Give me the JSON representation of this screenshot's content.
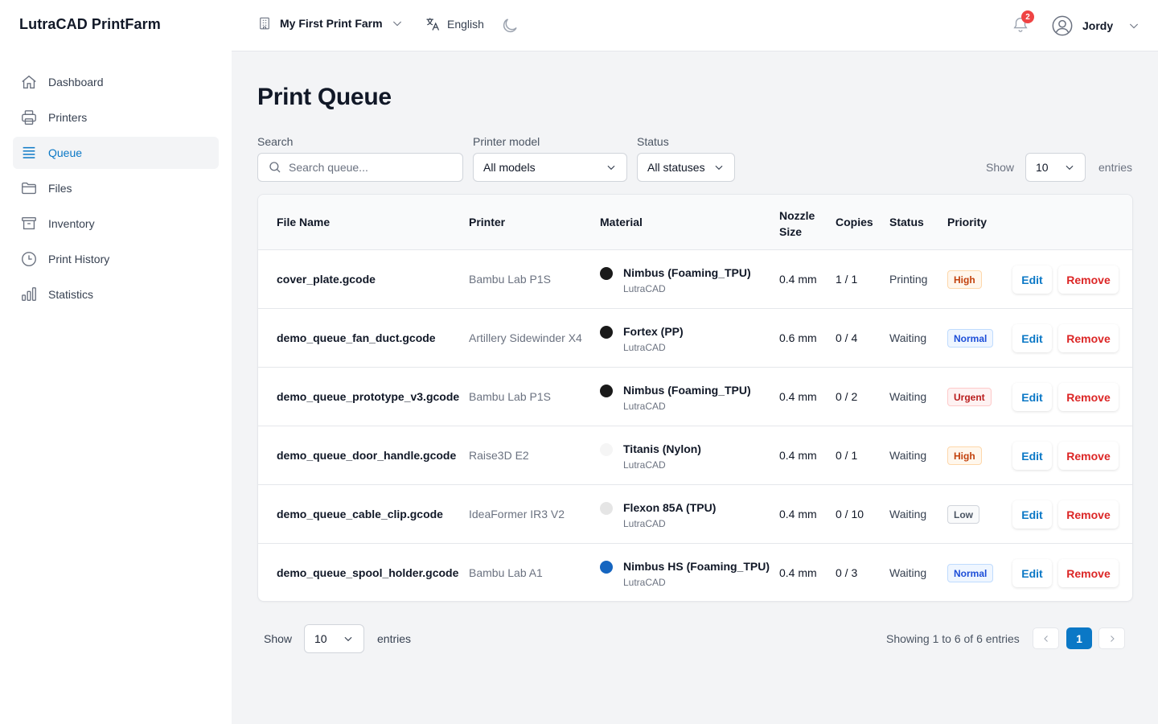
{
  "app": {
    "title": "LutraCAD PrintFarm"
  },
  "sidebar": {
    "items": [
      {
        "label": "Dashboard",
        "icon": "home-icon",
        "active": false
      },
      {
        "label": "Printers",
        "icon": "printer-icon",
        "active": false
      },
      {
        "label": "Queue",
        "icon": "queue-list-icon",
        "active": true
      },
      {
        "label": "Files",
        "icon": "folder-icon",
        "active": false
      },
      {
        "label": "Inventory",
        "icon": "archive-box-icon",
        "active": false
      },
      {
        "label": "Print History",
        "icon": "clock-icon",
        "active": false
      },
      {
        "label": "Statistics",
        "icon": "bar-chart-icon",
        "active": false
      }
    ]
  },
  "topbar": {
    "farm_name": "My First Print Farm",
    "language": "English",
    "notification_count": "2",
    "user_name": "Jordy"
  },
  "page": {
    "title": "Print Queue"
  },
  "filters": {
    "search_label": "Search",
    "search_placeholder": "Search queue...",
    "printer_model_label": "Printer model",
    "printer_model_value": "All models",
    "status_label": "Status",
    "status_value": "All statuses",
    "show_label": "Show",
    "show_value": "10",
    "entries_label": "entries"
  },
  "table": {
    "headers": {
      "file_name": "File Name",
      "printer": "Printer",
      "material": "Material",
      "nozzle_line1": "Nozzle",
      "nozzle_line2": "Size",
      "copies": "Copies",
      "status": "Status",
      "priority": "Priority"
    },
    "edit_label": "Edit",
    "remove_label": "Remove",
    "rows": [
      {
        "file": "cover_plate.gcode",
        "printer": "Bambu Lab P1S",
        "material": "Nimbus (Foaming_TPU)",
        "brand": "LutraCAD",
        "color": "#1a1a1a",
        "nozzle": "0.4 mm",
        "copies": "1 / 1",
        "status": "Printing",
        "priority": "High"
      },
      {
        "file": "demo_queue_fan_duct.gcode",
        "printer": "Artillery Sidewinder X4",
        "material": "Fortex (PP)",
        "brand": "LutraCAD",
        "color": "#1a1a1a",
        "nozzle": "0.6 mm",
        "copies": "0 / 4",
        "status": "Waiting",
        "priority": "Normal"
      },
      {
        "file": "demo_queue_prototype_v3.gcode",
        "printer": "Bambu Lab P1S",
        "material": "Nimbus (Foaming_TPU)",
        "brand": "LutraCAD",
        "color": "#1a1a1a",
        "nozzle": "0.4 mm",
        "copies": "0 / 2",
        "status": "Waiting",
        "priority": "Urgent"
      },
      {
        "file": "demo_queue_door_handle.gcode",
        "printer": "Raise3D E2",
        "material": "Titanis (Nylon)",
        "brand": "LutraCAD",
        "color": "#f5f5f5",
        "nozzle": "0.4 mm",
        "copies": "0 / 1",
        "status": "Waiting",
        "priority": "High"
      },
      {
        "file": "demo_queue_cable_clip.gcode",
        "printer": "IdeaFormer IR3 V2",
        "material": "Flexon 85A (TPU)",
        "brand": "LutraCAD",
        "color": "#e5e5e5",
        "nozzle": "0.4 mm",
        "copies": "0 / 10",
        "status": "Waiting",
        "priority": "Low"
      },
      {
        "file": "demo_queue_spool_holder.gcode",
        "printer": "Bambu Lab A1",
        "material": "Nimbus HS (Foaming_TPU)",
        "brand": "LutraCAD",
        "color": "#1565c0",
        "nozzle": "0.4 mm",
        "copies": "0 / 3",
        "status": "Waiting",
        "priority": "Normal"
      }
    ]
  },
  "priority_styles": {
    "High": {
      "fg": "#c2410c",
      "bg": "#fff7ed",
      "border": "#fed7aa"
    },
    "Normal": {
      "fg": "#1d4ed8",
      "bg": "#eff6ff",
      "border": "#bfdbfe"
    },
    "Urgent": {
      "fg": "#b91c1c",
      "bg": "#fef2f2",
      "border": "#fecaca"
    },
    "Low": {
      "fg": "#4b5563",
      "bg": "#f9fafb",
      "border": "#d1d5db"
    }
  },
  "footer": {
    "show_label": "Show",
    "show_value": "10",
    "entries_label": "entries",
    "showing_text": "Showing 1 to 6 of 6 entries",
    "current_page": "1"
  },
  "colors": {
    "accent": "#0b78c6",
    "danger": "#dc2626",
    "notification": "#ef4444"
  }
}
